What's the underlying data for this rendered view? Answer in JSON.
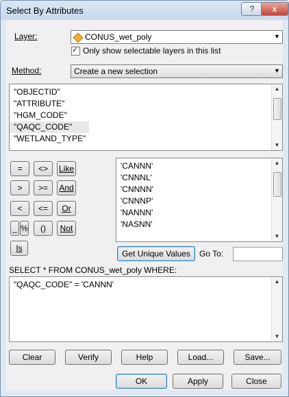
{
  "window": {
    "title": "Select By Attributes",
    "help_icon": "?",
    "close_icon": "x"
  },
  "layer": {
    "label": "Layer:",
    "value": "CONUS_wet_poly",
    "checkbox_label": "Only show selectable layers in this list",
    "checked": true
  },
  "method": {
    "label": "Method:",
    "value": "Create a new selection"
  },
  "fields": [
    "\"OBJECTID\"",
    "\"ATTRIBUTE\"",
    "\"HGM_CODE\"",
    "\"QAQC_CODE\"",
    "\"WETLAND_TYPE\""
  ],
  "fields_selected_index": 3,
  "operators": {
    "eq": "=",
    "ne": "<>",
    "like": "Like",
    "gt": ">",
    "ge": ">=",
    "and": "And",
    "lt": "<",
    "le": "<=",
    "or": "Or",
    "underscore": "_",
    "percent": "%",
    "parens": "()",
    "not": "Not",
    "is": "Is"
  },
  "values": [
    "'CANNN'",
    "'CNNNL'",
    "'CNNNN'",
    "'CNNNP'",
    "'NANNN'",
    "'NASNN'"
  ],
  "unique_values_button": "Get Unique Values",
  "goto_label": "Go To:",
  "goto_value": "",
  "query_header": "SELECT * FROM CONUS_wet_poly WHERE:",
  "query_text": "\"QAQC_CODE\" = 'CANNN'",
  "buttons": {
    "clear": "Clear",
    "verify": "Verify",
    "help": "Help",
    "load": "Load...",
    "save": "Save...",
    "ok": "OK",
    "apply": "Apply",
    "close": "Close"
  },
  "colors": {
    "title_bar": "#c7d8ee",
    "close_button": "#c6463a",
    "dialog_bg": "#f0f0f0",
    "layer_icon": "#f0b030"
  }
}
